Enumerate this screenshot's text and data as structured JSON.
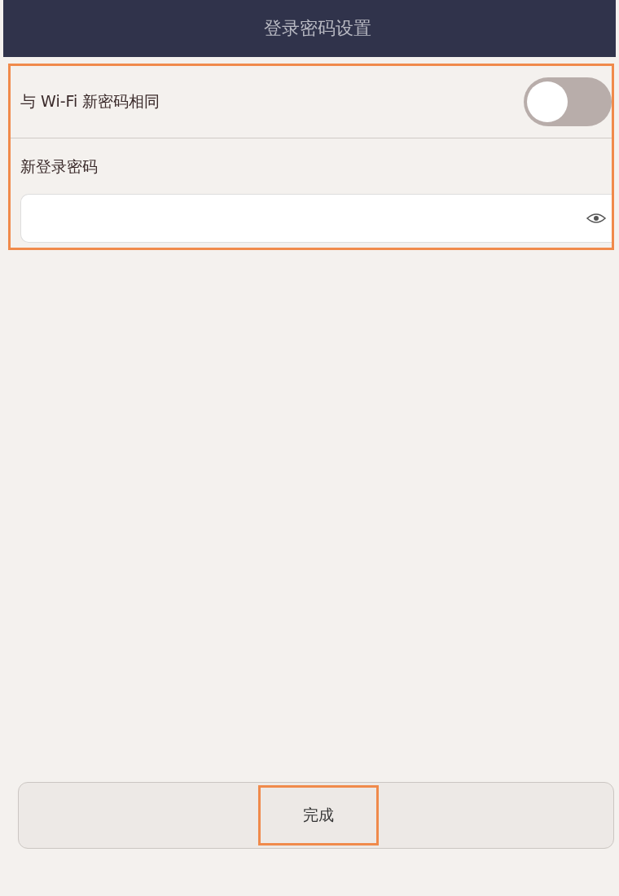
{
  "header": {
    "title": "登录密码设置"
  },
  "form": {
    "highlighted": true,
    "toggle_row": {
      "label": "与 Wi-Fi 新密码相同",
      "on": false
    },
    "password": {
      "label": "新登录密码"
    }
  },
  "done_button": {
    "label": "完成",
    "highlighted": true
  }
}
